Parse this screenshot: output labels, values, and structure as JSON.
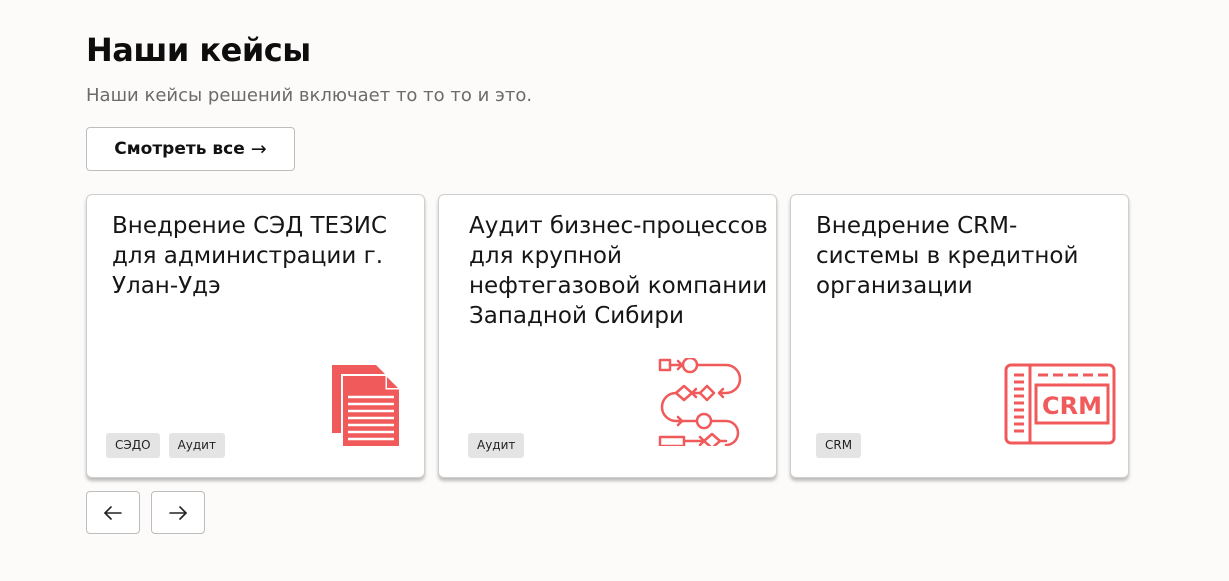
{
  "header": {
    "title": "Наши кейсы",
    "subtitle": "Наши кейсы решений включает то то то и это.",
    "view_all_label": "Смотреть все",
    "view_all_arrow": "→"
  },
  "accent_color": "#f05a5a",
  "cards": [
    {
      "title": "Внедрение СЭД ТЕЗИС для администрации г. Улан-Удэ",
      "tags": [
        "СЭДО",
        "Аудит"
      ],
      "icon": "documents-icon"
    },
    {
      "title": "Аудит бизнес-процессов для крупной нефтегазовой компании Западной Сибири",
      "tags": [
        "Аудит"
      ],
      "icon": "process-flow-icon"
    },
    {
      "title": "Внедрение CRM-системы в кредитной организации",
      "tags": [
        "CRM"
      ],
      "icon": "crm-icon",
      "icon_text": "CRM"
    }
  ],
  "navigation": {
    "prev_icon": "arrow-left-icon",
    "next_icon": "arrow-right-icon"
  }
}
